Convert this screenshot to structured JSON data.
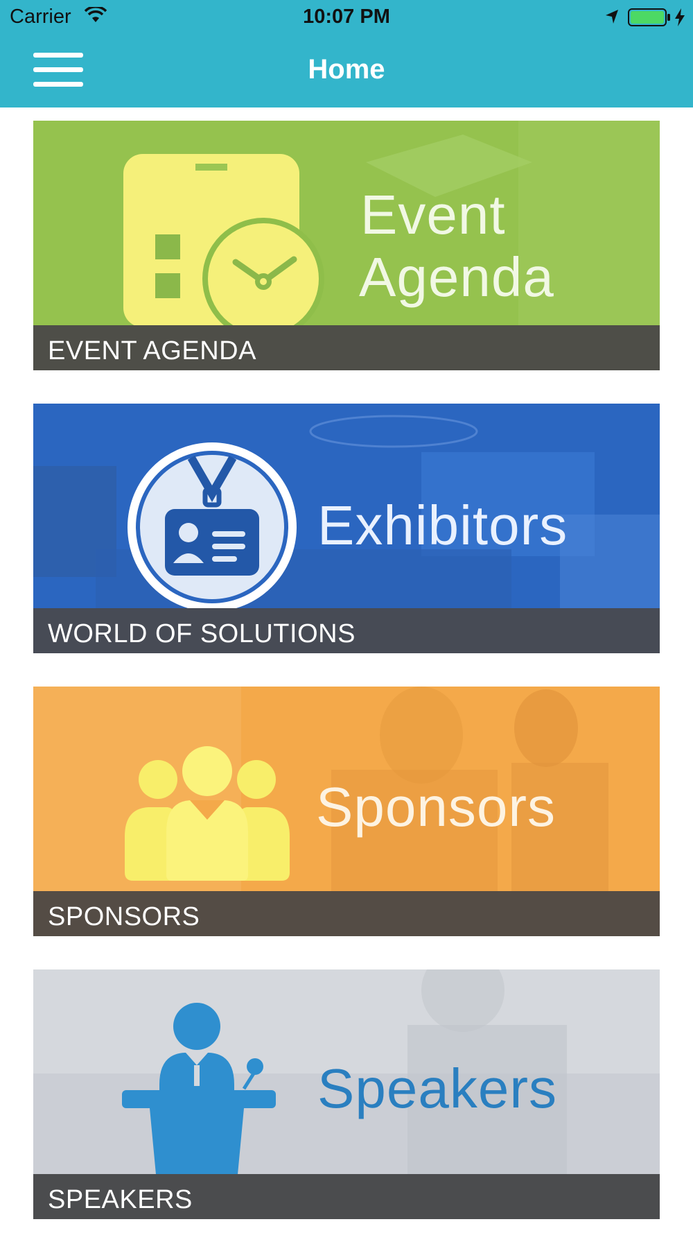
{
  "status_bar": {
    "carrier": "Carrier",
    "time": "10:07 PM",
    "icons": [
      "wifi-icon",
      "location-arrow-icon",
      "battery-icon",
      "charging-bolt-icon"
    ],
    "battery_color": "#4cd964"
  },
  "nav": {
    "title": "Home",
    "menu_icon": "hamburger-menu-icon",
    "background": "#33b5cb"
  },
  "tiles": [
    {
      "banner_title_line1": "Event",
      "banner_title_line2": "Agenda",
      "caption": "EVENT AGENDA",
      "icon": "badge-clock-icon",
      "background": "#9bc653"
    },
    {
      "banner_title": "Exhibitors",
      "caption": "WORLD OF SOLUTIONS",
      "icon": "id-badge-icon",
      "background": "#2b6cc4"
    },
    {
      "banner_title": "Sponsors",
      "caption": "SPONSORS",
      "icon": "people-group-icon",
      "background": "#f3a94a"
    },
    {
      "banner_title": "Speakers",
      "caption": "SPEAKERS",
      "icon": "speaker-podium-icon",
      "background": "#d6d8dc"
    }
  ]
}
